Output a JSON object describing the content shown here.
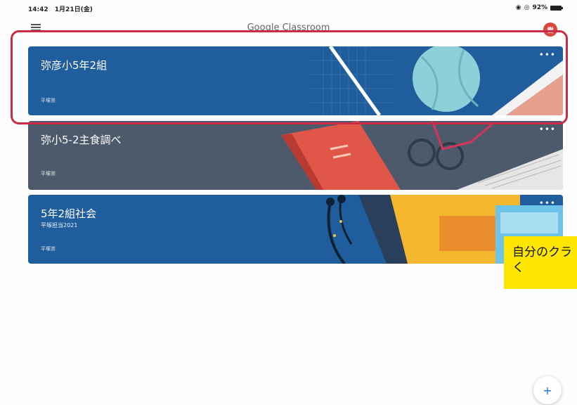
{
  "status_bar": {
    "time": "14:42",
    "date": "1月21日(金)",
    "battery": "92%",
    "wifi_icon": "wifi-icon"
  },
  "app_bar": {
    "title": "Google Classroom",
    "avatar_initial": "樹"
  },
  "classes": [
    {
      "name": "弥彦小5年2組",
      "section": "",
      "teacher": "平塚崇",
      "more": "•••",
      "color": "#1f5d9d"
    },
    {
      "name": "弥小5-2主食調べ",
      "section": "",
      "teacher": "平塚崇",
      "more": "•••",
      "color": "#4d5a6b"
    },
    {
      "name": "5年2組社会",
      "section": "平塚担当2021",
      "teacher": "平塚崇",
      "more": "•••",
      "color": "#1f5d9d"
    }
  ],
  "annotation": {
    "line1": "自分のクラ",
    "line2": "く"
  },
  "fab": {
    "label": "+"
  }
}
